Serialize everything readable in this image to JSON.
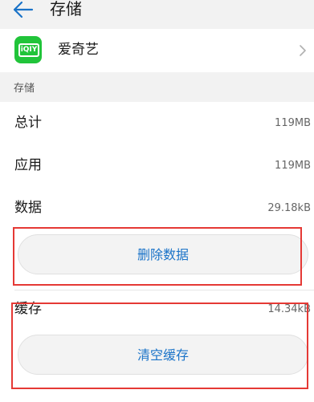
{
  "header": {
    "title": "存储"
  },
  "app": {
    "name": "爱奇艺",
    "icon_text": "iQIY"
  },
  "storage": {
    "section_title": "存储",
    "total_label": "总计",
    "total_value": "119MB",
    "app_label": "应用",
    "app_value": "119MB",
    "data_label": "数据",
    "data_value": "29.18kB",
    "delete_data_button": "删除数据"
  },
  "cache": {
    "label": "缓存",
    "value": "14.34kB",
    "clear_cache_button": "清空缓存"
  },
  "colors": {
    "accent": "#1a73c8",
    "highlight": "#e53935",
    "app_icon": "#21c43a"
  }
}
